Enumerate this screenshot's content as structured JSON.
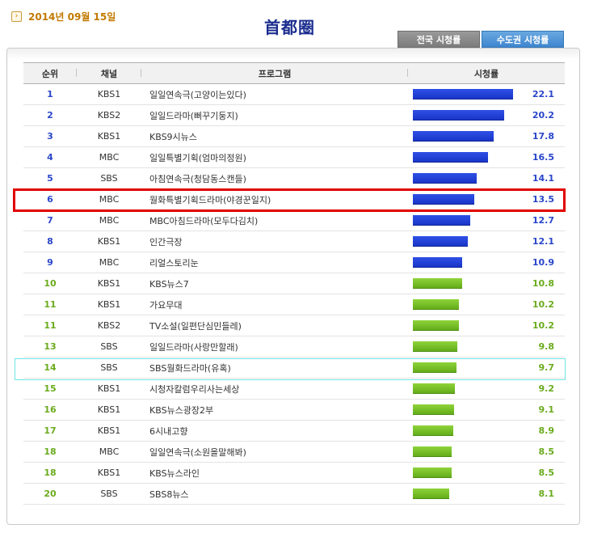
{
  "header": {
    "date_icon": "arrow-right-icon",
    "date": "2014년 09월 15일",
    "region_title": "首都圈",
    "tabs": [
      {
        "label": "전국 시청률",
        "active": false
      },
      {
        "label": "수도권 시청률",
        "active": true
      }
    ]
  },
  "table": {
    "columns": {
      "rank": "순위",
      "channel": "채널",
      "program": "프로그램",
      "rating": "시청률"
    },
    "bar_max_rating": 22.1,
    "rows": [
      {
        "rank": "1",
        "channel": "KBS1",
        "program": "일일연속극(고양이는있다)",
        "rating": "22.1",
        "color": "blue"
      },
      {
        "rank": "2",
        "channel": "KBS2",
        "program": "일일드라마(뻐꾸기둥지)",
        "rating": "20.2",
        "color": "blue"
      },
      {
        "rank": "3",
        "channel": "KBS1",
        "program": "KBS9시뉴스",
        "rating": "17.8",
        "color": "blue"
      },
      {
        "rank": "4",
        "channel": "MBC",
        "program": "일일특별기획(엄마의정원)",
        "rating": "16.5",
        "color": "blue"
      },
      {
        "rank": "5",
        "channel": "SBS",
        "program": "아침연속극(청담동스캔들)",
        "rating": "14.1",
        "color": "blue"
      },
      {
        "rank": "6",
        "channel": "MBC",
        "program": "월화특별기획드라마(야경꾼일지)",
        "rating": "13.5",
        "color": "blue"
      },
      {
        "rank": "7",
        "channel": "MBC",
        "program": "MBC아침드라마(모두다김치)",
        "rating": "12.7",
        "color": "blue"
      },
      {
        "rank": "8",
        "channel": "KBS1",
        "program": "인간극장",
        "rating": "12.1",
        "color": "blue"
      },
      {
        "rank": "9",
        "channel": "MBC",
        "program": "리얼스토리눈",
        "rating": "10.9",
        "color": "blue"
      },
      {
        "rank": "10",
        "channel": "KBS1",
        "program": "KBS뉴스7",
        "rating": "10.8",
        "color": "green"
      },
      {
        "rank": "11",
        "channel": "KBS1",
        "program": "가요무대",
        "rating": "10.2",
        "color": "green"
      },
      {
        "rank": "11",
        "channel": "KBS2",
        "program": "TV소설(일편단심민들레)",
        "rating": "10.2",
        "color": "green"
      },
      {
        "rank": "13",
        "channel": "SBS",
        "program": "일일드라마(사랑만할래)",
        "rating": "9.8",
        "color": "green"
      },
      {
        "rank": "14",
        "channel": "SBS",
        "program": "SBS월화드라마(유혹)",
        "rating": "9.7",
        "color": "green"
      },
      {
        "rank": "15",
        "channel": "KBS1",
        "program": "시청자칼럼우리사는세상",
        "rating": "9.2",
        "color": "green"
      },
      {
        "rank": "16",
        "channel": "KBS1",
        "program": "KBS뉴스광장2부",
        "rating": "9.1",
        "color": "green"
      },
      {
        "rank": "17",
        "channel": "KBS1",
        "program": "6시내고향",
        "rating": "8.9",
        "color": "green"
      },
      {
        "rank": "18",
        "channel": "MBC",
        "program": "일일연속극(소원을말해봐)",
        "rating": "8.5",
        "color": "green"
      },
      {
        "rank": "18",
        "channel": "KBS1",
        "program": "KBS뉴스라인",
        "rating": "8.5",
        "color": "green"
      },
      {
        "rank": "20",
        "channel": "SBS",
        "program": "SBS8뉴스",
        "rating": "8.1",
        "color": "green"
      }
    ]
  },
  "highlights": {
    "red_row_index": 5,
    "red_color": "#e10000",
    "cyan_row_index": 13,
    "cyan_color": "#6fe6e6"
  },
  "colors": {
    "bar_blue": "#2a46c9",
    "bar_green": "#6bab1e",
    "date_orange": "#c27a00",
    "title_navy": "#1b2d8f"
  }
}
